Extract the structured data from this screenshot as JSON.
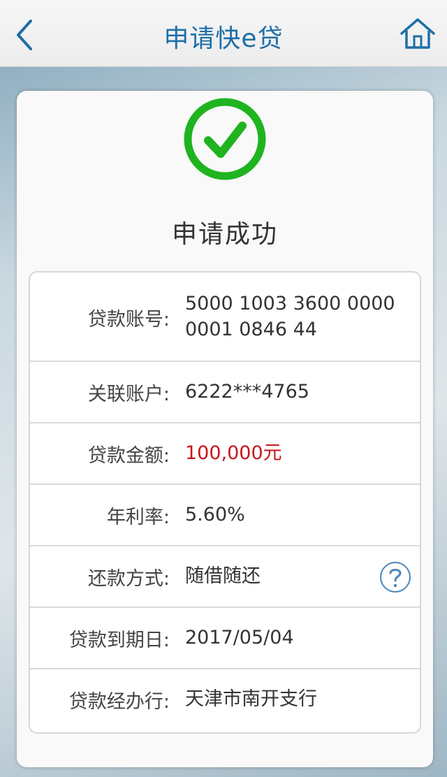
{
  "nav": {
    "title": "申请快e贷"
  },
  "result": {
    "status_text": "申请成功"
  },
  "details": [
    {
      "label": "贷款账号:",
      "value_line1": "5000 1003 3600 0000",
      "value_line2": "0001 0846 44"
    },
    {
      "label": "关联账户:",
      "value": "6222***4765"
    },
    {
      "label": "贷款金额:",
      "value": "100,000元"
    },
    {
      "label": "年利率:",
      "value": "5.60%"
    },
    {
      "label": "还款方式:",
      "value": "随借随还"
    },
    {
      "label": "贷款到期日:",
      "value": "2017/05/04"
    },
    {
      "label": "贷款经办行:",
      "value": "天津市南开支行"
    }
  ],
  "icons": {
    "back": "chevron-left-icon",
    "home": "home-icon",
    "success": "checkmark-circle-icon",
    "help": "question-mark-icon"
  },
  "colors": {
    "accent": "#1e6fa8",
    "success": "#1fb41f",
    "amount": "#c8161d"
  }
}
